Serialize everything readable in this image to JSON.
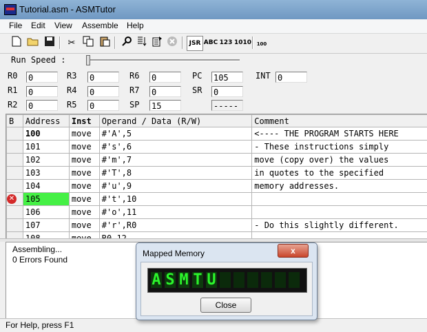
{
  "window": {
    "title": "Tutorial.asm - ASMTutor"
  },
  "menu": [
    "File",
    "Edit",
    "View",
    "Assemble",
    "Help"
  ],
  "toolbar": {
    "jsr_label": "JSR",
    "abc_label": "ABC",
    "num_label": "123",
    "bin_label": "1010",
    "hundred_label": "100"
  },
  "run_speed": {
    "label": "Run Speed :",
    "level": 0
  },
  "registers": {
    "R0": "0",
    "R1": "0",
    "R2": "0",
    "R3": "0",
    "R4": "0",
    "R5": "0",
    "R6": "0",
    "R7": "0",
    "SP": "15",
    "PC": "105",
    "SR": "0",
    "BLANK": "-----",
    "INT": "0"
  },
  "table": {
    "headers": [
      "B",
      "Address",
      "Inst",
      "Operand / Data (R/W)",
      "Comment"
    ],
    "rows": [
      {
        "addr": "100",
        "inst": "move",
        "operand": "#'A',5",
        "comment": "<---- THE PROGRAM STARTS HERE"
      },
      {
        "addr": "101",
        "inst": "move",
        "operand": "#'s',6",
        "comment": "- These instructions simply"
      },
      {
        "addr": "102",
        "inst": "move",
        "operand": "#'m',7",
        "comment": "move (copy over) the values"
      },
      {
        "addr": "103",
        "inst": "move",
        "operand": "#'T',8",
        "comment": "in quotes to the specified"
      },
      {
        "addr": "104",
        "inst": "move",
        "operand": "#'u',9",
        "comment": "memory addresses."
      },
      {
        "addr": "105",
        "inst": "move",
        "operand": "#'t',10",
        "comment": ""
      },
      {
        "addr": "106",
        "inst": "move",
        "operand": "#'o',11",
        "comment": ""
      },
      {
        "addr": "107",
        "inst": "move",
        "operand": "#'r',R0",
        "comment": "- Do this slightly different."
      },
      {
        "addr": "108",
        "inst": "move",
        "operand": "R0,12",
        "comment": ""
      }
    ]
  },
  "output": {
    "lines": [
      "Assembling...",
      "0 Errors Found"
    ]
  },
  "status": {
    "text": "For Help, press F1"
  },
  "dialog": {
    "title": "Mapped Memory",
    "close_x": "x",
    "display": [
      "A",
      "S",
      "M",
      "T",
      "U",
      "",
      "",
      "",
      "",
      "",
      ""
    ],
    "close_button": "Close"
  },
  "colors": {
    "current_row": "#45f045",
    "breakpoint": "#d42a2a",
    "lcd_text": "#2cf52c"
  }
}
